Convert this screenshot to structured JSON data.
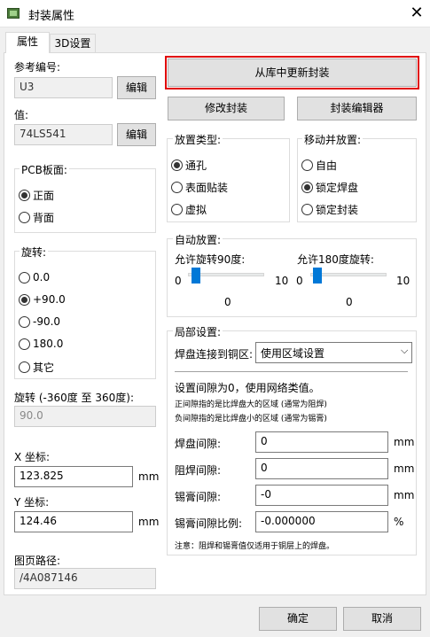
{
  "window": {
    "title": "封装属性",
    "close_symbol": "✕"
  },
  "tabs": [
    {
      "label": "属性"
    },
    {
      "label": "3D设置"
    }
  ],
  "left": {
    "ref_label": "参考编号:",
    "ref_value": "U3",
    "ref_edit": "编辑",
    "value_label": "值:",
    "value_value": "74LS541",
    "value_edit": "编辑",
    "pcb_side": {
      "title": "PCB板面:",
      "options": [
        "正面",
        "背面"
      ],
      "selected": 0
    },
    "rotation": {
      "title": "旋转:",
      "options": [
        "0.0",
        "+90.0",
        "-90.0",
        "180.0",
        "其它"
      ],
      "selected": 1
    },
    "rot_custom_label": "旋转 (-360度 至 360度):",
    "rot_custom_value": "90.0",
    "x_label": "X 坐标:",
    "x_value": "123.825",
    "x_unit": "mm",
    "y_label": "Y 坐标:",
    "y_value": "124.46",
    "y_unit": "mm",
    "path_label": "图页路径:",
    "path_value": "/4A087146"
  },
  "right": {
    "update_btn": "从库中更新封装",
    "modify_btn": "修改封装",
    "editor_btn": "封装编辑器",
    "placement": {
      "title": "放置类型:",
      "options": [
        "通孔",
        "表面贴装",
        "虚拟"
      ],
      "selected": 0
    },
    "move": {
      "title": "移动并放置:",
      "options": [
        "自由",
        "锁定焊盘",
        "锁定封装"
      ],
      "selected": 1
    },
    "auto": {
      "title": "自动放置:",
      "s90_label": "允许旋转90度:",
      "s90_min": "0",
      "s90_max": "10",
      "s90_value": "0",
      "s180_label": "允许180度旋转:",
      "s180_min": "0",
      "s180_max": "10",
      "s180_value": "0"
    },
    "local": {
      "title": "局部设置:",
      "copper_label": "焊盘连接到铜区:",
      "copper_value": "使用区域设置",
      "note1": "设置间隙为0，使用网络类值。",
      "note2": "正间隙指的是比焊盘大的区域 (通常为阻焊)",
      "note3": "负间隙指的是比焊盘小的区域 (通常为锡膏)",
      "rows": [
        {
          "label": "焊盘间隙:",
          "value": "0",
          "unit": "mm"
        },
        {
          "label": "阻焊间隙:",
          "value": "0",
          "unit": "mm"
        },
        {
          "label": "锡膏间隙:",
          "value": "-0",
          "unit": "mm"
        },
        {
          "label": "锡膏间隙比例:",
          "value": "-0.000000",
          "unit": "%"
        }
      ],
      "footnote": "注意：阻焊和锡膏值仅适用于铜层上的焊盘。"
    }
  },
  "footer": {
    "ok": "确定",
    "cancel": "取消"
  }
}
